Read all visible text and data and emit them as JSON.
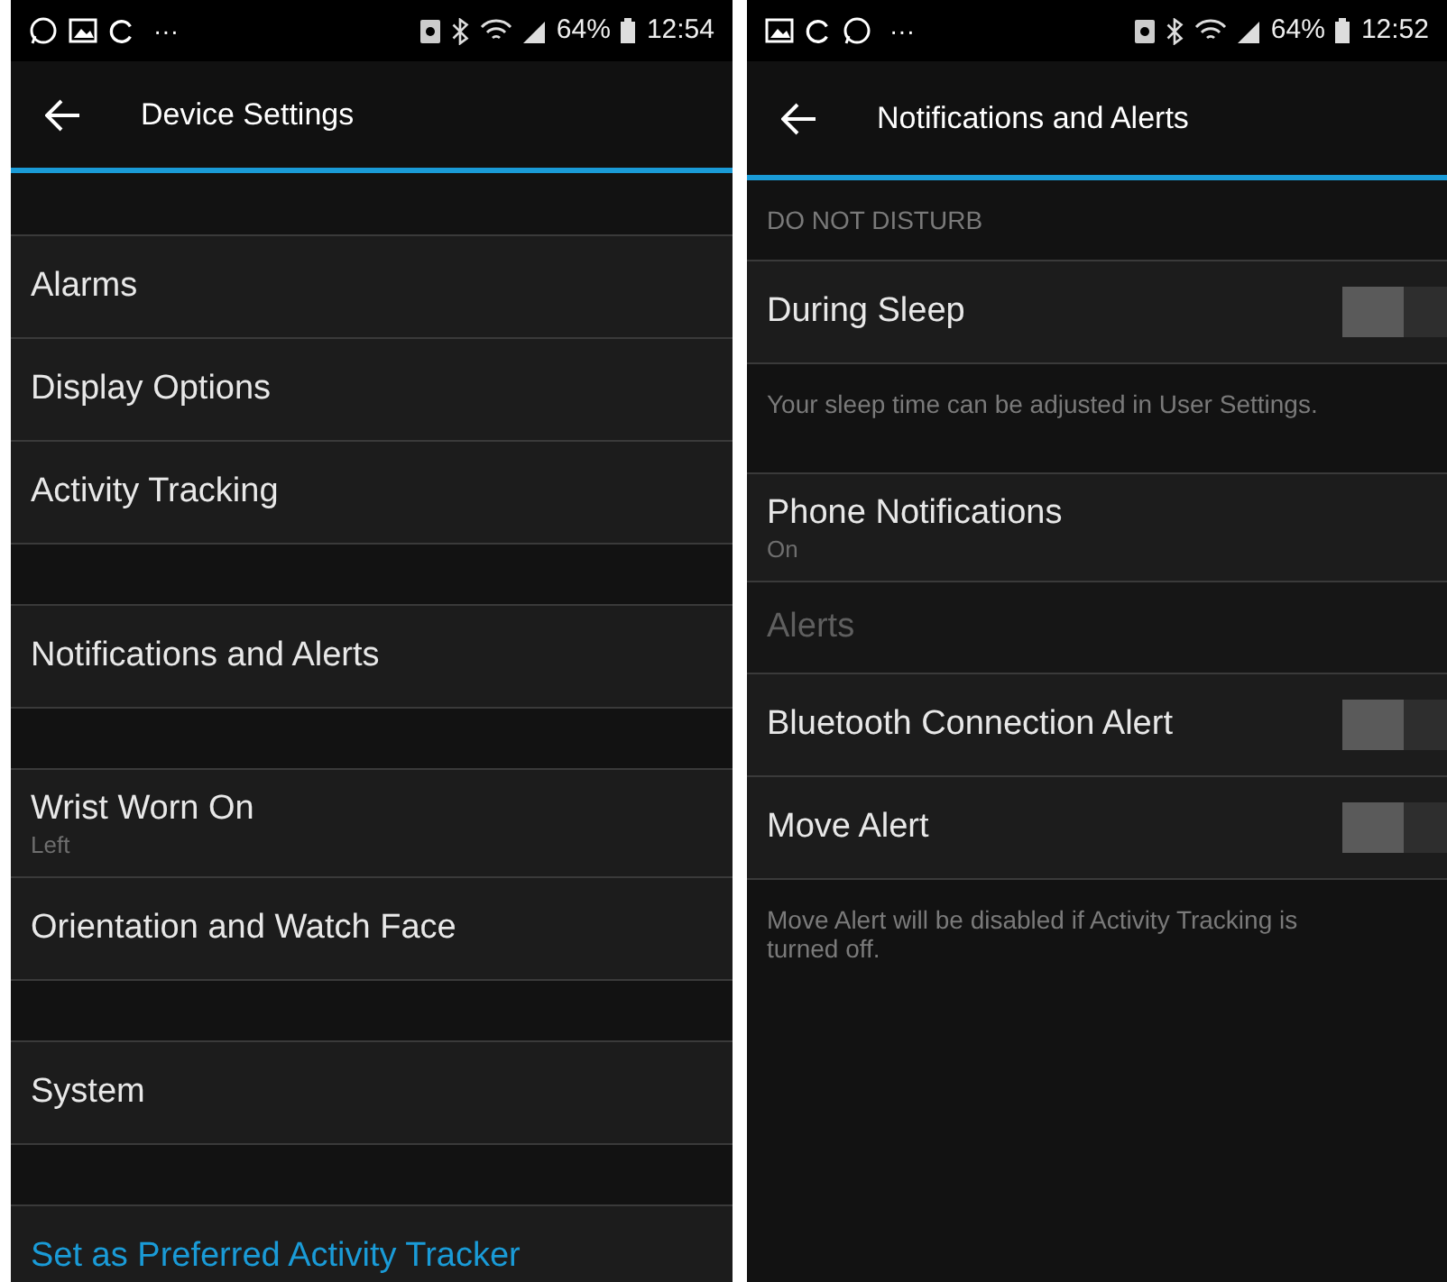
{
  "screens": [
    {
      "status_bar": {
        "overflow": "···",
        "battery": "64%",
        "time": "12:54"
      },
      "title": "Device Settings",
      "rows": [
        {
          "kind": "spacer"
        },
        {
          "kind": "item",
          "label": "Alarms"
        },
        {
          "kind": "item",
          "label": "Display Options"
        },
        {
          "kind": "item",
          "label": "Activity Tracking"
        },
        {
          "kind": "spacer"
        },
        {
          "kind": "item",
          "label": "Notifications and Alerts"
        },
        {
          "kind": "spacer"
        },
        {
          "kind": "item",
          "label": "Wrist Worn On",
          "value": "Left"
        },
        {
          "kind": "item",
          "label": "Orientation and Watch Face"
        },
        {
          "kind": "spacer"
        },
        {
          "kind": "item",
          "label": "System"
        },
        {
          "kind": "spacer"
        },
        {
          "kind": "link",
          "label": "Set as Preferred Activity Tracker"
        }
      ]
    },
    {
      "status_bar": {
        "overflow": "···",
        "battery": "64%",
        "time": "12:52"
      },
      "title": "Notifications and Alerts",
      "rows": [
        {
          "kind": "header",
          "label": "DO NOT DISTURB"
        },
        {
          "kind": "toggle",
          "label": "During Sleep",
          "on": false
        },
        {
          "kind": "note",
          "label": "Your sleep time can be adjusted in User Settings."
        },
        {
          "kind": "item",
          "label": "Phone Notifications",
          "value": "On"
        },
        {
          "kind": "subheader",
          "label": "Alerts"
        },
        {
          "kind": "toggle",
          "label": "Bluetooth Connection Alert",
          "on": false
        },
        {
          "kind": "toggle",
          "label": "Move Alert",
          "on": false
        },
        {
          "kind": "note",
          "label": "Move Alert will be disabled if Activity Tracking is turned off."
        }
      ]
    }
  ]
}
